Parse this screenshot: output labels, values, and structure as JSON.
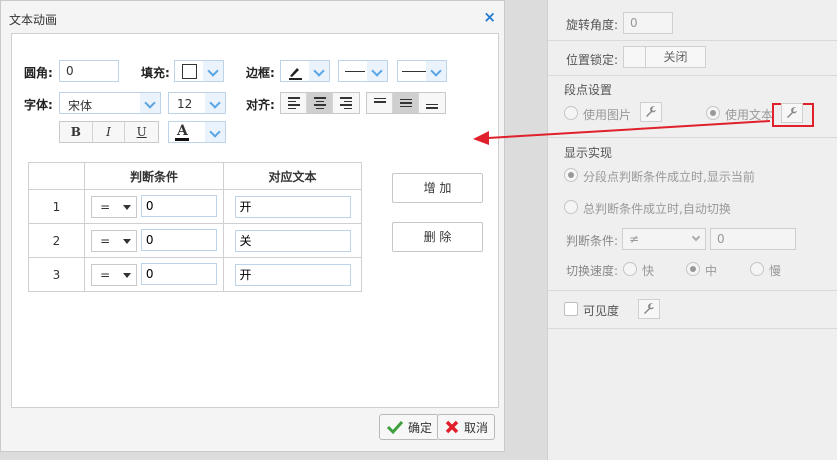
{
  "dialog": {
    "title": "文本动画",
    "close_glyph": "×",
    "style": {
      "radius_label": "圆角:",
      "radius_value": "0",
      "fill_label": "填充:",
      "border_label": "边框:",
      "font_label": "字体:",
      "font_value": "宋体",
      "size_value": "12",
      "align_label": "对齐:",
      "bold": "B",
      "italic": "I",
      "underline": "U",
      "font_color": "A"
    },
    "table": {
      "headers": [
        "",
        "判断条件",
        "对应文本"
      ],
      "rows": [
        {
          "index": "1",
          "op": "=",
          "cond": "0",
          "text": "开"
        },
        {
          "index": "2",
          "op": "=",
          "cond": "0",
          "text": "关"
        },
        {
          "index": "3",
          "op": "=",
          "cond": "0",
          "text": "开"
        }
      ]
    },
    "add_label": "增 加",
    "delete_label": "删 除",
    "ok_label": "确定",
    "cancel_label": "取消"
  },
  "panel": {
    "rotation_label": "旋转角度:",
    "rotation_value": "0",
    "lock_label": "位置锁定:",
    "lock_value": "关闭",
    "segment_title": "段点设置",
    "use_image": "使用图片",
    "use_text": "使用文本",
    "display_title": "显示实现",
    "option_segment": "分段点判断条件成立时,显示当前",
    "option_total": "总判断条件成立时,自动切换",
    "judge_label": "判断条件:",
    "judge_op": "≠",
    "judge_value": "0",
    "speed_label": "切换速度:",
    "speed_fast": "快",
    "speed_mid": "中",
    "speed_slow": "慢",
    "visibility_label": "可见度"
  },
  "colors": {
    "accent": "#1f7ad1",
    "highlight": "#e0202a"
  }
}
